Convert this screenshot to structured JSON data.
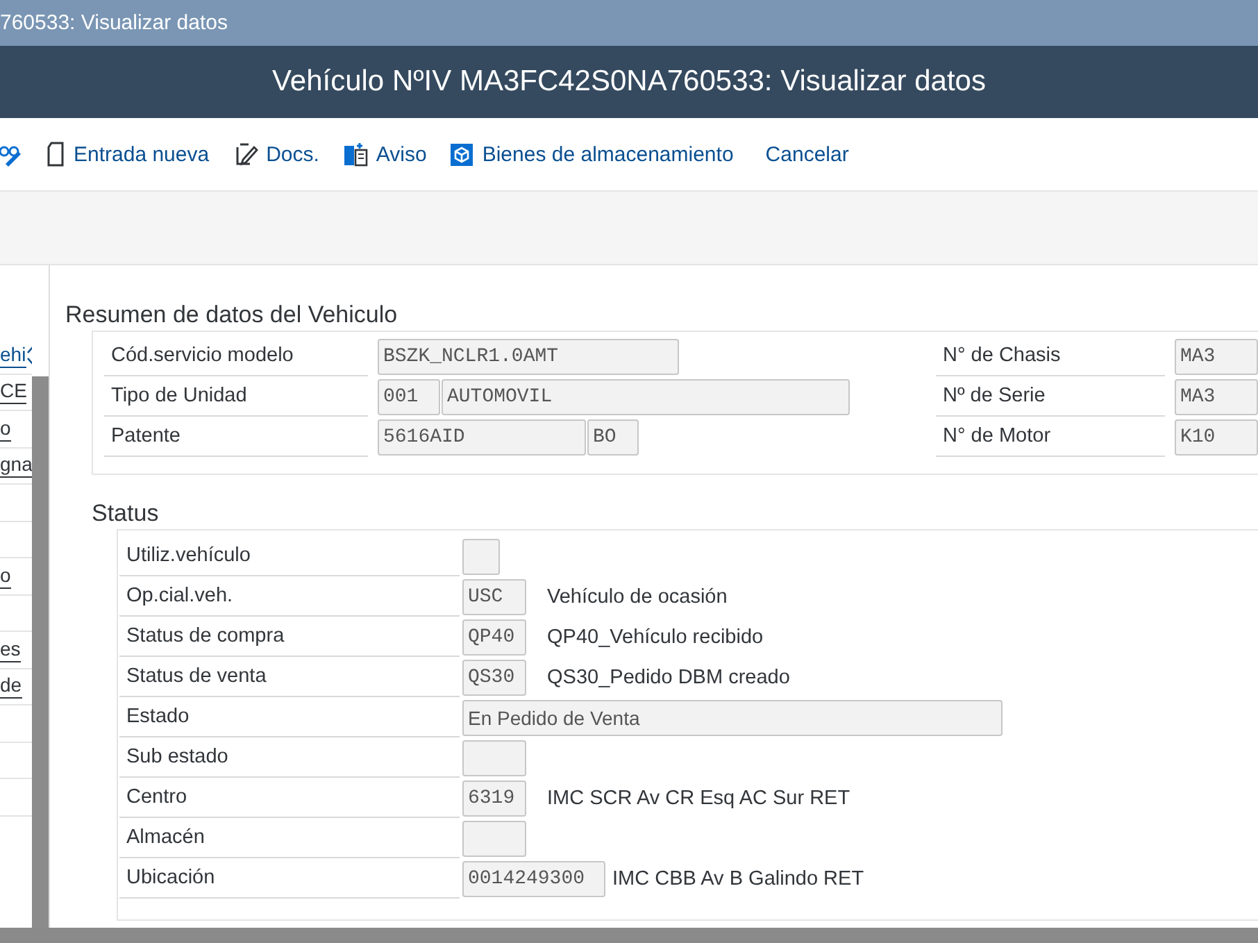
{
  "window": {
    "title": "760533: Visualizar datos"
  },
  "header": {
    "title": "Vehículo NºIV MA3FC42S0NA760533: Visualizar datos"
  },
  "toolbar": [
    {
      "kind": "icon"
    },
    {
      "kind": "labeled",
      "label": "Entrada nueva"
    },
    {
      "kind": "labeled",
      "label": "Docs."
    },
    {
      "kind": "labeled",
      "label": "Aviso"
    },
    {
      "kind": "labeled",
      "label": "Bienes de almacenamiento"
    },
    {
      "kind": "text",
      "label": "Cancelar"
    }
  ],
  "left_panel": {
    "items": [
      {
        "kind": "select",
        "text": "ehi"
      },
      {
        "kind": "field",
        "text": "CE"
      },
      {
        "kind": "field",
        "text": "o"
      },
      {
        "kind": "field",
        "text": "gna"
      },
      {
        "kind": "row"
      },
      {
        "kind": "row"
      },
      {
        "kind": "field",
        "text": "o"
      },
      {
        "kind": "row"
      },
      {
        "kind": "field",
        "text": "es"
      },
      {
        "kind": "field",
        "text": "de"
      },
      {
        "kind": "row"
      },
      {
        "kind": "row"
      },
      {
        "kind": "row"
      }
    ]
  },
  "summary": {
    "title": "Resumen de datos del Vehiculo",
    "left_rows": [
      {
        "label": "Cód.servicio modelo",
        "fields": [
          "BSZK_NCLR1.0AMT"
        ]
      },
      {
        "label": "Tipo de Unidad",
        "fields": [
          "001",
          "AUTOMOVIL"
        ]
      },
      {
        "label": "Patente",
        "fields": [
          "5616AID",
          "BO"
        ]
      }
    ],
    "right_rows": [
      {
        "label": "N° de Chasis",
        "fields": [
          "MA3"
        ]
      },
      {
        "label": "Nº de Serie",
        "fields": [
          "MA3"
        ]
      },
      {
        "label": "N° de Motor",
        "fields": [
          "K10"
        ]
      }
    ]
  },
  "status": {
    "title": "Status",
    "rows": [
      {
        "label": "Utiliz.vehículo"
      },
      {
        "label": "Op.cial.veh.",
        "value": "USC",
        "description": "Vehículo de ocasión"
      },
      {
        "label": "Status de compra",
        "value": "QP40",
        "description": "QP40_Vehículo recibido"
      },
      {
        "label": "Status de venta",
        "value": "QS30",
        "description": "QS30_Pedido DBM creado"
      },
      {
        "label": "Estado",
        "value": "En Pedido de Venta",
        "kind": "text"
      },
      {
        "label": "Sub estado"
      },
      {
        "label": "Centro",
        "value": "6319",
        "description": "IMC SCR Av CR Esq AC Sur RET"
      },
      {
        "label": "Almacén"
      },
      {
        "label": "Ubicación",
        "value": "0014249300",
        "description": "IMC CBB Av B Galindo RET"
      }
    ]
  }
}
